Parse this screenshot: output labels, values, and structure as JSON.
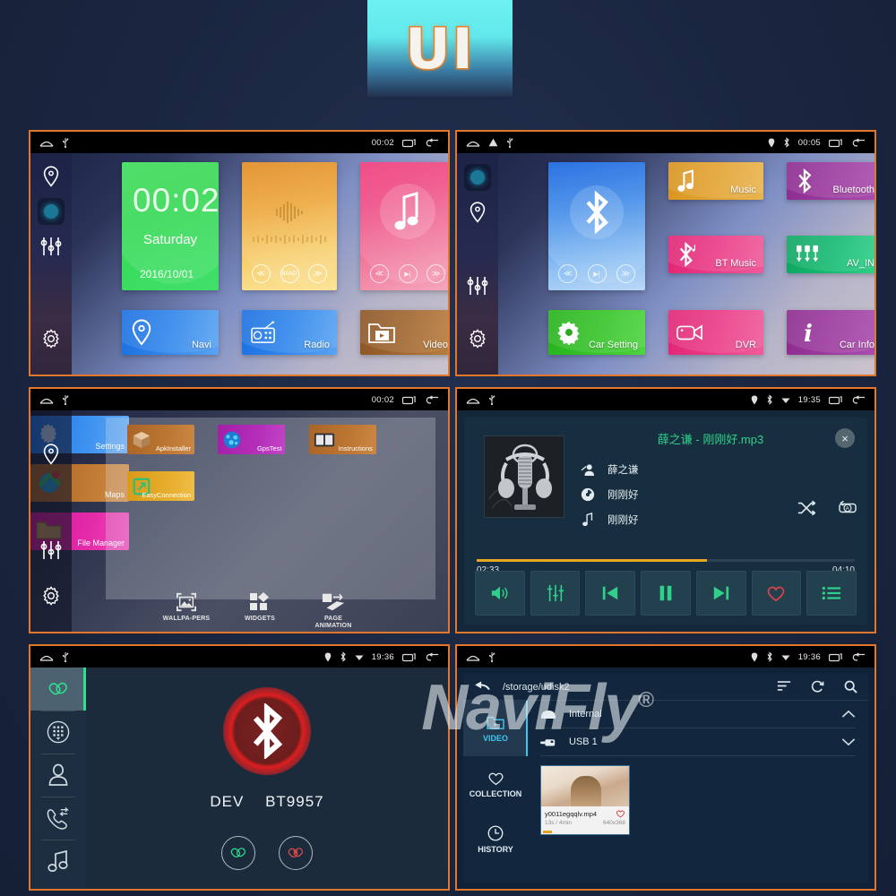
{
  "hero": {
    "label": "UI"
  },
  "panels": {
    "home": {
      "statusbar": {
        "time": "00:02",
        "icons": [
          "home-icon",
          "usb-icon",
          "recents-icon",
          "back-icon"
        ]
      },
      "rail": [
        "location-icon",
        "active-dot",
        "equalizer-icon",
        "gear-icon"
      ],
      "clock": {
        "time": "00:02",
        "day": "Saturday",
        "date": "2016/10/01"
      },
      "radio_tile": {
        "prev": "≪",
        "band": "BAND",
        "next": "≫"
      },
      "music_tile": {
        "prev": "≪",
        "play": "▶|",
        "next": "≫"
      },
      "tiles": [
        {
          "label": "Navi",
          "icon": "location-pin-icon"
        },
        {
          "label": "Radio",
          "icon": "radio-icon"
        },
        {
          "label": "Video",
          "icon": "video-folder-icon"
        }
      ]
    },
    "apps": {
      "statusbar": {
        "time": "00:05",
        "icons": [
          "home-icon",
          "warning-icon",
          "usb-icon",
          "gps-icon",
          "bluetooth-icon",
          "recents-icon",
          "back-icon"
        ]
      },
      "rail": [
        "active-dot",
        "location-icon",
        "equalizer-icon",
        "gear-icon"
      ],
      "bt_tile": {
        "prev": "≪",
        "play": "▶|",
        "next": "≫"
      },
      "tiles": [
        {
          "label": "Music",
          "icon": "music-note-icon"
        },
        {
          "label": "Bluetooth",
          "icon": "bluetooth-icon"
        },
        {
          "label": "BT Music",
          "icon": "bt-music-icon"
        },
        {
          "label": "AV_IN",
          "icon": "av-in-icon"
        },
        {
          "label": "Car Setting",
          "icon": "gear-icon"
        },
        {
          "label": "DVR",
          "icon": "camcorder-icon"
        },
        {
          "label": "Car Info",
          "icon": "info-icon"
        }
      ]
    },
    "drawer": {
      "statusbar": {
        "time": "00:02",
        "icons": [
          "home-icon",
          "usb-icon",
          "recents-icon",
          "back-icon"
        ]
      },
      "rail": [
        "location-icon",
        "equalizer-icon",
        "gear-icon"
      ],
      "left_apps": [
        {
          "label": "Settings",
          "icon": "gear-app-icon"
        },
        {
          "label": "Maps",
          "icon": "maps-icon"
        },
        {
          "label": "File Manager",
          "icon": "folder-icon"
        }
      ],
      "apps": [
        {
          "label": "ApkInstaller",
          "icon": "box-icon"
        },
        {
          "label": "GpsTest",
          "icon": "globe-icon"
        },
        {
          "label": "Instructions",
          "icon": "book-icon"
        },
        {
          "label": "EasyConnection",
          "icon": "link-square-icon"
        }
      ],
      "bottombar": [
        {
          "label": "WALLPA-PERS",
          "icon": "wallpaper-icon"
        },
        {
          "label": "WIDGETS",
          "icon": "widgets-icon"
        },
        {
          "label": "PAGE ANIMATION",
          "icon": "page-animation-icon"
        }
      ]
    },
    "player": {
      "statusbar": {
        "time": "19:35",
        "icons": [
          "home-icon",
          "usb-icon",
          "gps-icon",
          "bluetooth-icon",
          "wifi-icon",
          "recents-icon",
          "back-icon"
        ]
      },
      "track_file": "薛之谦 - 刚刚好.mp3",
      "artist": "薛之谦",
      "album": "刚刚好",
      "title": "刚刚好",
      "elapsed": "02:33",
      "duration": "04:10",
      "progress_percent": 61,
      "close_label": "×",
      "shuffle_icon": "shuffle-icon",
      "repeat_icon": "repeat-all-icon",
      "controls": [
        {
          "icon": "volume-icon"
        },
        {
          "icon": "equalizer-icon"
        },
        {
          "icon": "previous-icon"
        },
        {
          "icon": "pause-icon"
        },
        {
          "icon": "next-icon"
        },
        {
          "icon": "favorite-icon"
        },
        {
          "icon": "playlist-icon"
        }
      ]
    },
    "bluetooth": {
      "statusbar": {
        "time": "19:36",
        "icons": [
          "home-icon",
          "usb-icon",
          "gps-icon",
          "bluetooth-icon",
          "wifi-icon",
          "recents-icon",
          "back-icon"
        ]
      },
      "nav": [
        {
          "icon": "link-icon",
          "active": true
        },
        {
          "icon": "dialpad-icon",
          "active": false
        },
        {
          "icon": "contact-icon",
          "active": false
        },
        {
          "icon": "call-history-icon",
          "active": false
        },
        {
          "icon": "music-note-icon",
          "active": false
        }
      ],
      "device_label": "DEV",
      "device_name": "BT9957",
      "actions": [
        {
          "icon": "connect-icon",
          "color": "#2ee08e"
        },
        {
          "icon": "disconnect-icon",
          "color": "#e04a4a"
        }
      ]
    },
    "files": {
      "statusbar": {
        "time": "19:36",
        "icons": [
          "home-icon",
          "usb-icon",
          "gps-icon",
          "bluetooth-icon",
          "wifi-icon",
          "recents-icon",
          "back-icon"
        ]
      },
      "path": "/storage/udisk2",
      "tools": [
        "sort-icon",
        "refresh-icon",
        "search-icon"
      ],
      "nav": [
        {
          "label": "VIDEO",
          "icon": "video-folder-icon",
          "active": true
        },
        {
          "label": "COLLECTION",
          "icon": "heart-icon",
          "active": false
        },
        {
          "label": "HISTORY",
          "icon": "clock-icon",
          "active": false
        }
      ],
      "sources": [
        {
          "label": "Internal",
          "icon": "drive-icon",
          "state": "expanded",
          "chevron": "up"
        },
        {
          "label": "USB 1",
          "icon": "usb-drive-icon",
          "state": "collapsed",
          "chevron": "down"
        }
      ],
      "items": [
        {
          "name": "y0011egqqlv.mp4",
          "duration": "13s / 4min",
          "resolution": "640x368",
          "favorite": true
        }
      ]
    }
  },
  "watermark": {
    "text": "NaviFly",
    "mark": "®"
  },
  "colors": {
    "background": "#1a2640",
    "panel_border": "#e2762a",
    "accent_green": "#2fd18a",
    "accent_cyan": "#3fc6f0",
    "progress": "#e7a81f"
  }
}
